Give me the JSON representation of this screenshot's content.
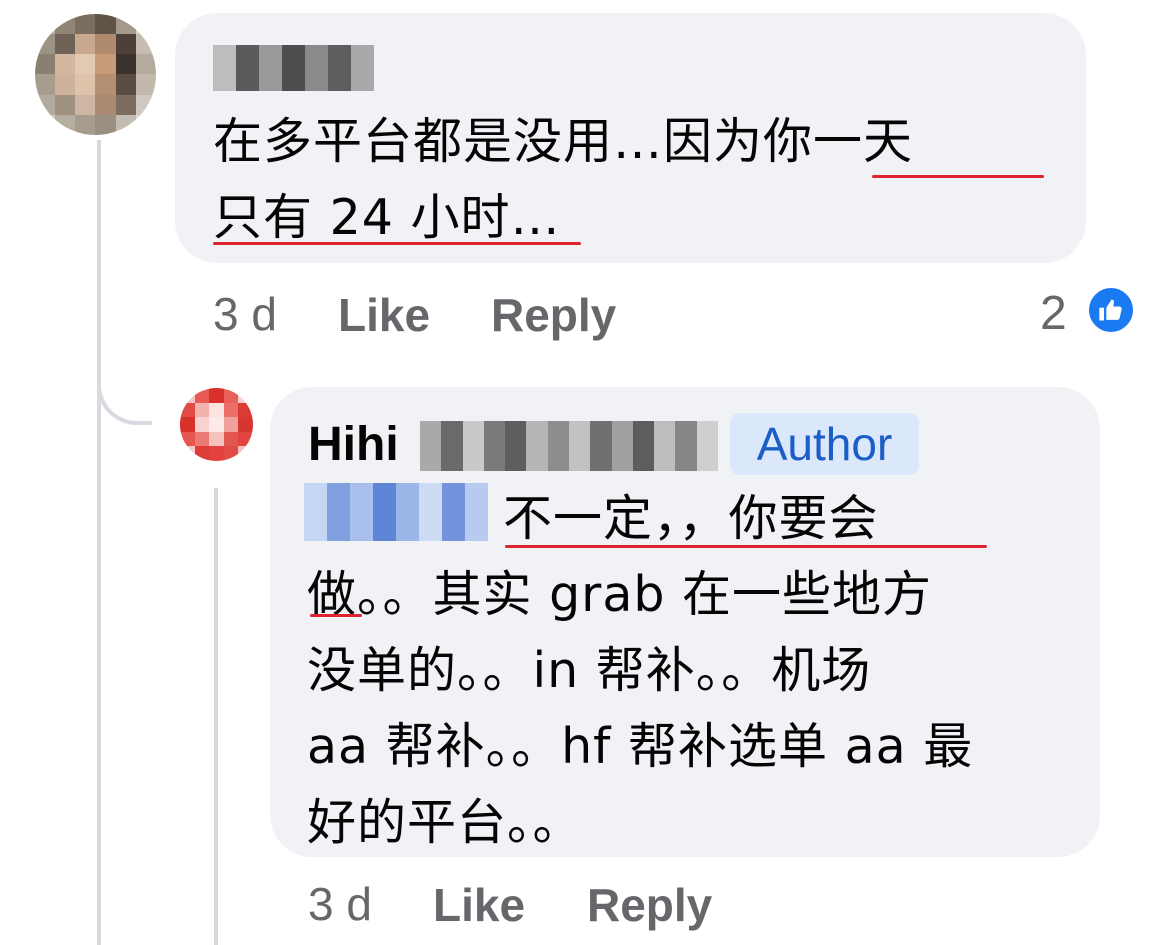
{
  "comments": [
    {
      "text": "在多平台都是没用…因为你一天\n只有 24 小时…",
      "time": "3 d",
      "like_label": "Like",
      "reply_label": "Reply",
      "reaction_count": "2",
      "reaction_icon": "thumbs-up-icon"
    },
    {
      "author": "Hihi",
      "badge": "Author",
      "text": "不一定，，你要会\n做。。其实 grab 在一些地方\n没单的。。in 帮补。。机场\naa 帮补。。hf 帮补选单 aa 最\n好的平台。。",
      "time": "3 d",
      "like_label": "Like",
      "reply_label": "Reply"
    }
  ],
  "colors": {
    "bubble": "#f0f2f5",
    "meta_text": "#65676b",
    "badge_bg": "#dbe7fb",
    "badge_text": "#1b5ec6",
    "like_blue": "#1a7af2",
    "spellcheck_red": "#e0242f",
    "thread_line": "#d8dadf"
  }
}
